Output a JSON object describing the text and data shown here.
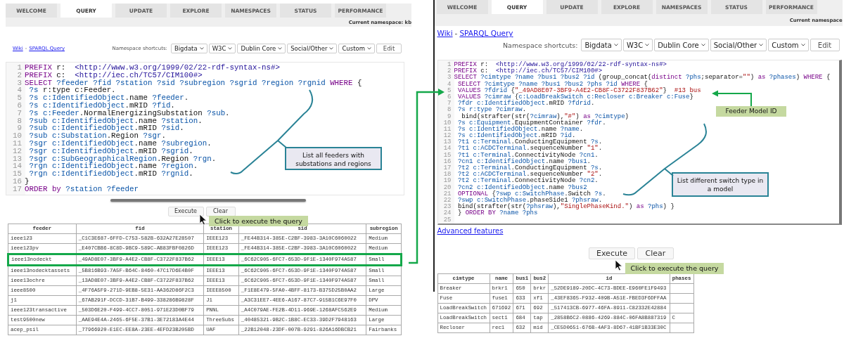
{
  "panels": [
    {
      "tabs": [
        {
          "label": "WELCOME",
          "selected": false
        },
        {
          "label": "QUERY",
          "selected": true
        },
        {
          "label": "UPDATE",
          "selected": false
        },
        {
          "label": "EXPLORE",
          "selected": false
        },
        {
          "label": "NAMESPACES",
          "selected": false
        },
        {
          "label": "STATUS",
          "selected": false
        },
        {
          "label": "PERFORMANCE",
          "selected": false
        }
      ],
      "namespace": "Current namespace: kb",
      "links": {
        "wiki": "Wiki",
        "separator": "-",
        "query": "SPARQL Query"
      },
      "shortcuts": {
        "label": "Namespace shortcuts:",
        "dropdowns": [
          "Bigdata",
          "W3C",
          "Dublin Core",
          "Social/Other",
          "Custom"
        ],
        "edit": "Edit"
      },
      "editor": [
        {
          "n": "1",
          "t": [
            {
              "kind": "kw",
              "text": "PREFIX"
            },
            {
              "kind": "txt",
              "text": " r:  "
            },
            {
              "kind": "iri",
              "text": "<http://www.w3.org/1999/02/22-rdf-syntax-ns#>"
            }
          ]
        },
        {
          "n": "2",
          "t": [
            {
              "kind": "kw",
              "text": "PREFIX"
            },
            {
              "kind": "txt",
              "text": " c:  "
            },
            {
              "kind": "iri",
              "text": "<http://iec.ch/TC57/CIM100#>"
            }
          ]
        },
        {
          "n": "3",
          "t": [
            {
              "kind": "kw",
              "text": "SELECT"
            },
            {
              "kind": "var",
              "text": " ?feeder ?fid ?station ?sid ?subregion ?sgrid ?region ?rgnid "
            },
            {
              "kind": "kw",
              "text": "WHERE"
            },
            {
              "kind": "txt",
              "text": " {"
            }
          ]
        },
        {
          "n": "4",
          "t": [
            {
              "kind": "var",
              "text": " ?s "
            },
            {
              "kind": "txt",
              "text": "r:type c:Feeder."
            }
          ]
        },
        {
          "n": "5",
          "t": [
            {
              "kind": "var",
              "text": " ?s c:IdentifiedObject"
            },
            {
              "kind": "txt",
              "text": ".name "
            },
            {
              "kind": "var",
              "text": "?feeder"
            },
            {
              "kind": "txt",
              "text": "."
            }
          ]
        },
        {
          "n": "6",
          "t": [
            {
              "kind": "var",
              "text": " ?s c:IdentifiedObject"
            },
            {
              "kind": "txt",
              "text": ".mRID "
            },
            {
              "kind": "var",
              "text": "?fid"
            },
            {
              "kind": "txt",
              "text": "."
            }
          ]
        },
        {
          "n": "7",
          "t": [
            {
              "kind": "var",
              "text": " ?s c:Feeder"
            },
            {
              "kind": "txt",
              "text": ".NormalEnergizingSubstation "
            },
            {
              "kind": "var",
              "text": "?sub"
            },
            {
              "kind": "txt",
              "text": "."
            }
          ]
        },
        {
          "n": "8",
          "t": [
            {
              "kind": "var",
              "text": " ?sub c:IdentifiedObject"
            },
            {
              "kind": "txt",
              "text": ".name "
            },
            {
              "kind": "var",
              "text": "?station"
            },
            {
              "kind": "txt",
              "text": "."
            }
          ]
        },
        {
          "n": "9",
          "t": [
            {
              "kind": "var",
              "text": " ?sub c:IdentifiedObject"
            },
            {
              "kind": "txt",
              "text": ".mRID "
            },
            {
              "kind": "var",
              "text": "?sid"
            },
            {
              "kind": "txt",
              "text": "."
            }
          ]
        },
        {
          "n": "10",
          "t": [
            {
              "kind": "var",
              "text": " ?sub c:Substation"
            },
            {
              "kind": "txt",
              "text": ".Region "
            },
            {
              "kind": "var",
              "text": "?sgr"
            },
            {
              "kind": "txt",
              "text": "."
            }
          ]
        },
        {
          "n": "11",
          "t": [
            {
              "kind": "var",
              "text": " ?sgr c:IdentifiedObject"
            },
            {
              "kind": "txt",
              "text": ".name "
            },
            {
              "kind": "var",
              "text": "?subregion"
            },
            {
              "kind": "txt",
              "text": "."
            }
          ]
        },
        {
          "n": "12",
          "t": [
            {
              "kind": "var",
              "text": " ?sgr c:IdentifiedObject"
            },
            {
              "kind": "txt",
              "text": ".mRID "
            },
            {
              "kind": "var",
              "text": "?sgrid"
            },
            {
              "kind": "txt",
              "text": "."
            }
          ]
        },
        {
          "n": "13",
          "t": [
            {
              "kind": "var",
              "text": " ?sgr c:SubGeographicalRegion"
            },
            {
              "kind": "txt",
              "text": ".Region "
            },
            {
              "kind": "var",
              "text": "?rgn"
            },
            {
              "kind": "txt",
              "text": "."
            }
          ]
        },
        {
          "n": "14",
          "t": [
            {
              "kind": "var",
              "text": " ?rgn c:IdentifiedObject"
            },
            {
              "kind": "txt",
              "text": ".name "
            },
            {
              "kind": "var",
              "text": "?region"
            },
            {
              "kind": "txt",
              "text": "."
            }
          ]
        },
        {
          "n": "15",
          "t": [
            {
              "kind": "var",
              "text": " ?rgn c:IdentifiedObject"
            },
            {
              "kind": "txt",
              "text": ".mRID "
            },
            {
              "kind": "var",
              "text": "?rgnid"
            },
            {
              "kind": "txt",
              "text": "."
            }
          ]
        },
        {
          "n": "16",
          "t": [
            {
              "kind": "txt",
              "text": "}"
            }
          ]
        },
        {
          "n": "17",
          "t": [
            {
              "kind": "kw",
              "text": "ORDER by"
            },
            {
              "kind": "var",
              "text": " ?station ?feeder"
            }
          ]
        }
      ],
      "buttons": [
        {
          "kind": "execute",
          "label": "Execute"
        },
        {
          "kind": "clear",
          "label": "Clear"
        }
      ],
      "tooltip": "Click to execute the query",
      "table": {
        "columns": [
          "feeder",
          "fid",
          "station",
          "sid",
          "subregion"
        ],
        "rows": [
          {
            "highlighted": false,
            "cells": [
              "ieee123",
              "_C1C3E687-6FFD-C753-582B-632A27E28507",
              "IEEE123",
              "_FE44B314-385E-C2BF-3983-3A10C6060022",
              "Medium"
            ]
          },
          {
            "highlighted": false,
            "cells": [
              "ieee123pv",
              "_E407CBB6-8C8D-9BC9-589C-AB83FBF0826D",
              "IEEE123",
              "_FE44B314-385E-C2BF-3983-3A10C6060022",
              "Medium"
            ]
          },
          {
            "highlighted": true,
            "cells": [
              "ieee13nodeckt",
              "_49AD8E07-3BF9-A4E2-CB8F-C3722F837B62",
              "IEEE13",
              "_6C62C905-6FC7-653D-9F1E-1340F974A587",
              "Small"
            ]
          },
          {
            "highlighted": false,
            "cells": [
              "ieee13nodecktassets",
              "_5B816B93-7A5F-B64C-8460-47C17D6E4B0F",
              "IEEE13",
              "_6C62C905-6FC7-653D-9F1E-1340F974A587",
              "Small"
            ]
          },
          {
            "highlighted": false,
            "cells": [
              "ieee13ochre",
              "_13AD8E07-3BF9-A4E2-CB8F-C3722F837B62",
              "IEEE13",
              "_6C62C905-6FC7-653D-9F1E-1340F974A587",
              "Small"
            ]
          },
          {
            "highlighted": false,
            "cells": [
              "ieee8500",
              "_4F76A5F9-271D-9EB8-5E31-AA362D86F2C3",
              "IEEE8500",
              "_F1E8E479-5FA0-4BFF-8173-B375D25B0AA2",
              "Large"
            ]
          },
          {
            "highlighted": false,
            "cells": [
              "j1",
              "_67AB291F-DCCD-31B7-B499-338286B9828F",
              "J1",
              "_A3C31EE7-4EE6-A167-87C7-915B1C6E97F0",
              "DPV"
            ]
          },
          {
            "highlighted": false,
            "cells": [
              "ieee123transactive",
              "_503D6E20-F499-4CC7-8051-971E23D0BF79",
              "PNNL",
              "_A4C079AE-FE2B-4D11-969E-1268AFC562E9",
              "Medium"
            ]
          },
          {
            "highlighted": false,
            "cells": [
              "test9500new",
              "_AAE94E4A-2465-6F5E-37B1-3E72183A4E44",
              "ThreeSubs",
              "_40485321-9B2C-1B8C-EC33-39D2F7948163",
              "Large"
            ]
          },
          {
            "highlighted": false,
            "cells": [
              "acep_psil",
              "_77966920-E1EC-EE8A-23EE-4EFD23B205BD",
              "UAF",
              "_22B12048-23DF-007B-9291-826A16DBCB21",
              "Fairbanks"
            ]
          }
        ]
      }
    },
    {
      "tabs": [
        {
          "label": "WELCOME",
          "selected": false
        },
        {
          "label": "QUERY",
          "selected": true
        },
        {
          "label": "UPDATE",
          "selected": false
        },
        {
          "label": "EXPLORE",
          "selected": false
        },
        {
          "label": "NAMESPACES",
          "selected": false
        },
        {
          "label": "STATUS",
          "selected": false
        },
        {
          "label": "PERFORMANCE",
          "selected": false
        }
      ],
      "namespace": "Current namespace",
      "links": {
        "wiki": "Wiki",
        "separator": "-",
        "query": "SPARQL Query"
      },
      "shortcuts": {
        "label": "Namespace shortcuts:",
        "dropdowns": [
          "Bigdata",
          "W3C",
          "Dublin Core",
          "Social/Other",
          "Custom"
        ],
        "edit": "Edit"
      },
      "editor": [
        {
          "n": "1",
          "t": [
            {
              "kind": "kw",
              "text": "PREFIX"
            },
            {
              "kind": "txt",
              "text": " r:  "
            },
            {
              "kind": "iri",
              "text": "<http://www.w3.org/1999/02/22-rdf-syntax-ns#>"
            }
          ]
        },
        {
          "n": "2",
          "t": [
            {
              "kind": "kw",
              "text": "PREFIX"
            },
            {
              "kind": "txt",
              "text": " c:  "
            },
            {
              "kind": "iri",
              "text": "<http://iec.ch/TC57/CIM100#>"
            }
          ]
        },
        {
          "n": "3",
          "t": [
            {
              "kind": "kw",
              "text": "SELECT"
            },
            {
              "kind": "var",
              "text": " ?cimtype ?name ?bus1 ?bus2 ?id "
            },
            {
              "kind": "txt",
              "text": "(group_concat("
            },
            {
              "kind": "kw",
              "text": "distinct"
            },
            {
              "kind": "var",
              "text": " ?phs"
            },
            {
              "kind": "txt",
              "text": ";separator="
            },
            {
              "kind": "str",
              "text": "\"\""
            },
            {
              "kind": "txt",
              "text": ") "
            },
            {
              "kind": "kw",
              "text": "as"
            },
            {
              "kind": "var",
              "text": " ?phases"
            },
            {
              "kind": "txt",
              "text": ") "
            },
            {
              "kind": "kw",
              "text": "WHERE"
            },
            {
              "kind": "txt",
              "text": " {"
            }
          ]
        },
        {
          "n": "4",
          "t": [
            {
              "kind": "kw",
              "text": " SELECT"
            },
            {
              "kind": "var",
              "text": " ?cimtype ?name ?bus1 ?bus2 ?phs ?id "
            },
            {
              "kind": "kw",
              "text": "WHERE"
            },
            {
              "kind": "txt",
              "text": " {"
            }
          ]
        },
        {
          "n": "5",
          "t": [
            {
              "kind": "kw",
              "text": " VALUES"
            },
            {
              "kind": "var",
              "text": " ?fdrid "
            },
            {
              "kind": "txt",
              "text": "{"
            },
            {
              "kind": "str",
              "text": "\"_49AD8E07-3BF9-A4E2-CB8F-C3722F837B62\""
            },
            {
              "kind": "txt",
              "text": "}  "
            },
            {
              "kind": "cmt",
              "text": "#13 bus"
            }
          ]
        },
        {
          "n": "6",
          "t": [
            {
              "kind": "kw",
              "text": " VALUES"
            },
            {
              "kind": "var",
              "text": " ?cimraw "
            },
            {
              "kind": "txt",
              "text": "{"
            },
            {
              "kind": "var",
              "text": "c:LoadBreakSwitch c:Recloser c:Breaker c:Fuse"
            },
            {
              "kind": "txt",
              "text": "}"
            }
          ]
        },
        {
          "n": "7",
          "t": [
            {
              "kind": "var",
              "text": " ?fdr c:IdentifiedObject"
            },
            {
              "kind": "txt",
              "text": ".mRID "
            },
            {
              "kind": "var",
              "text": "?fdrid"
            },
            {
              "kind": "txt",
              "text": "."
            }
          ]
        },
        {
          "n": "8",
          "t": [
            {
              "kind": "var",
              "text": " ?s r:type ?cimraw"
            },
            {
              "kind": "txt",
              "text": "."
            }
          ]
        },
        {
          "n": "9",
          "t": [
            {
              "kind": "txt",
              "text": "  bind(strafter(str("
            },
            {
              "kind": "var",
              "text": "?cimraw"
            },
            {
              "kind": "txt",
              "text": "),"
            },
            {
              "kind": "str",
              "text": "\"#\""
            },
            {
              "kind": "txt",
              "text": ") "
            },
            {
              "kind": "kw",
              "text": "as"
            },
            {
              "kind": "var",
              "text": " ?cimtype"
            },
            {
              "kind": "txt",
              "text": ")"
            }
          ]
        },
        {
          "n": "10",
          "t": [
            {
              "kind": "var",
              "text": " ?s c:Equipment"
            },
            {
              "kind": "txt",
              "text": ".EquipmentContainer "
            },
            {
              "kind": "var",
              "text": "?fdr"
            },
            {
              "kind": "txt",
              "text": "."
            }
          ]
        },
        {
          "n": "11",
          "t": [
            {
              "kind": "var",
              "text": " ?s c:IdentifiedObject"
            },
            {
              "kind": "txt",
              "text": ".name "
            },
            {
              "kind": "var",
              "text": "?name"
            },
            {
              "kind": "txt",
              "text": "."
            }
          ]
        },
        {
          "n": "12",
          "t": [
            {
              "kind": "var",
              "text": " ?s c:IdentifiedObject"
            },
            {
              "kind": "txt",
              "text": ".mRID "
            },
            {
              "kind": "var",
              "text": "?id"
            },
            {
              "kind": "txt",
              "text": "."
            }
          ]
        },
        {
          "n": "13",
          "t": [
            {
              "kind": "var",
              "text": " ?t1 c:Terminal"
            },
            {
              "kind": "txt",
              "text": ".ConductingEquipment "
            },
            {
              "kind": "var",
              "text": "?s"
            },
            {
              "kind": "txt",
              "text": "."
            }
          ]
        },
        {
          "n": "14",
          "t": [
            {
              "kind": "var",
              "text": " ?t1 c:ACDCTerminal"
            },
            {
              "kind": "txt",
              "text": ".sequenceNumber "
            },
            {
              "kind": "str",
              "text": "\"1\""
            },
            {
              "kind": "txt",
              "text": "."
            }
          ]
        },
        {
          "n": "15",
          "t": [
            {
              "kind": "var",
              "text": " ?t1 c:Terminal"
            },
            {
              "kind": "txt",
              "text": ".ConnectivityNode "
            },
            {
              "kind": "var",
              "text": "?cn1"
            },
            {
              "kind": "txt",
              "text": "."
            }
          ]
        },
        {
          "n": "16",
          "t": [
            {
              "kind": "var",
              "text": " ?cn1 c:IdentifiedObject"
            },
            {
              "kind": "txt",
              "text": ".name "
            },
            {
              "kind": "var",
              "text": "?bus1"
            },
            {
              "kind": "txt",
              "text": "."
            }
          ]
        },
        {
          "n": "17",
          "t": [
            {
              "kind": "var",
              "text": " ?t2 c:Terminal"
            },
            {
              "kind": "txt",
              "text": ".ConductingEquipment "
            },
            {
              "kind": "var",
              "text": "?s"
            },
            {
              "kind": "txt",
              "text": "."
            }
          ]
        },
        {
          "n": "18",
          "t": [
            {
              "kind": "var",
              "text": " ?t2 c:ACDCTerminal"
            },
            {
              "kind": "txt",
              "text": ".sequenceNumber "
            },
            {
              "kind": "str",
              "text": "\"2\""
            },
            {
              "kind": "txt",
              "text": "."
            }
          ]
        },
        {
          "n": "19",
          "t": [
            {
              "kind": "var",
              "text": " ?t2 c:Terminal"
            },
            {
              "kind": "txt",
              "text": ".ConnectivityNode "
            },
            {
              "kind": "var",
              "text": "?cn2"
            },
            {
              "kind": "txt",
              "text": "."
            }
          ]
        },
        {
          "n": "20",
          "t": [
            {
              "kind": "var",
              "text": " ?cn2 c:IdentifiedObject"
            },
            {
              "kind": "txt",
              "text": ".name "
            },
            {
              "kind": "var",
              "text": "?bus2"
            }
          ]
        },
        {
          "n": "21",
          "t": [
            {
              "kind": "kw",
              "text": " OPTIONAL"
            },
            {
              "kind": "txt",
              "text": " {"
            },
            {
              "kind": "var",
              "text": "?swp c:SwitchPhase"
            },
            {
              "kind": "txt",
              "text": ".Switch "
            },
            {
              "kind": "var",
              "text": "?s"
            },
            {
              "kind": "txt",
              "text": "."
            }
          ]
        },
        {
          "n": "22",
          "t": [
            {
              "kind": "var",
              "text": " ?swp c:SwitchPhase"
            },
            {
              "kind": "txt",
              "text": ".phaseSide1 "
            },
            {
              "kind": "var",
              "text": "?phsraw"
            },
            {
              "kind": "txt",
              "text": "."
            }
          ]
        },
        {
          "n": "23",
          "t": [
            {
              "kind": "txt",
              "text": " bind(strafter(str("
            },
            {
              "kind": "var",
              "text": "?phsraw"
            },
            {
              "kind": "txt",
              "text": "),"
            },
            {
              "kind": "str",
              "text": "\"SinglePhaseKind.\""
            },
            {
              "kind": "txt",
              "text": ") "
            },
            {
              "kind": "kw",
              "text": "as"
            },
            {
              "kind": "var",
              "text": " ?phs"
            },
            {
              "kind": "txt",
              "text": ") }"
            }
          ]
        },
        {
          "n": "24",
          "t": [
            {
              "kind": "txt",
              "text": " } "
            },
            {
              "kind": "kw",
              "text": "ORDER BY"
            },
            {
              "kind": "var",
              "text": " ?name ?phs"
            }
          ]
        },
        {
          "n": "25"
        }
      ],
      "advanced_link": "Advanced features",
      "buttons": [
        {
          "kind": "execute",
          "label": "Execute"
        },
        {
          "kind": "clear",
          "label": "Clear"
        }
      ],
      "tooltip": "Click to execute the query",
      "table": {
        "columns": [
          "cimtype",
          "name",
          "bus1",
          "bus2",
          "id",
          "phases"
        ],
        "rows": [
          {
            "highlighted": false,
            "cells": [
              "Breaker",
              "brkr1",
              "650",
              "brkr",
              "_52DE9189-20DC-4C73-BDEE-E960FE1F9493",
              null
            ]
          },
          {
            "highlighted": false,
            "cells": [
              "Fuse",
              "fuse1",
              "633",
              "xf1",
              "_43EF8365-F932-409B-A51E-FBED3F6DFFAA",
              null
            ]
          },
          {
            "highlighted": false,
            "cells": [
              "LoadBreakSwitch",
              "671692",
              "671",
              "692",
              "_517413CB-6977-46FA-8911-C82332E42884",
              null
            ]
          },
          {
            "highlighted": false,
            "cells": [
              "LoadBreakSwitch",
              "sect1",
              "684",
              "tap",
              "_2858B6C2-0886-4269-884C-06FA8B887319",
              "C"
            ]
          },
          {
            "highlighted": false,
            "cells": [
              "Recloser",
              "rec1",
              "632",
              "mid",
              "_CE5D0651-676B-4AF3-8D67-41BF1B33E30C",
              null
            ]
          }
        ]
      }
    }
  ],
  "annotations": {
    "callouts": [
      "List all feeders with substations and regions",
      "List different switch type in a model"
    ],
    "model_id_label": "Feeder Model ID"
  }
}
